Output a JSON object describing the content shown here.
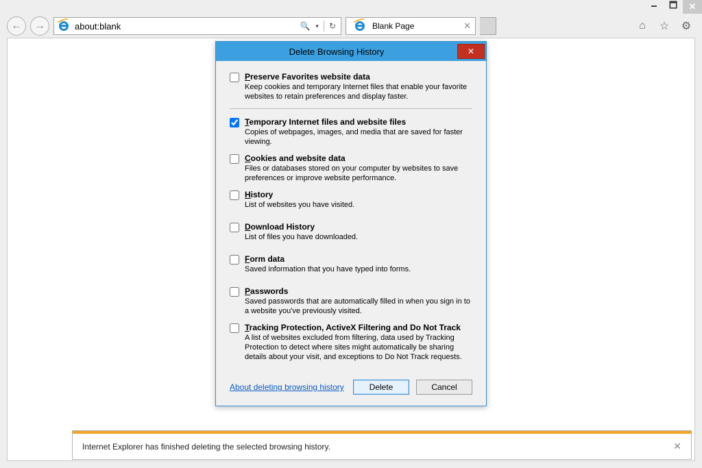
{
  "window": {
    "minimize_glyph": "🗕",
    "maximize_glyph": "🗖",
    "close_glyph": "✕"
  },
  "toolbar": {
    "back_glyph": "←",
    "forward_glyph": "→",
    "address_value": "about:blank",
    "search_glyph": "🔍",
    "dropdown_glyph": "▾",
    "refresh_glyph": "↻",
    "tab_label": "Blank Page",
    "tab_close_glyph": "✕",
    "home_glyph": "⌂",
    "star_glyph": "☆",
    "gear_glyph": "⚙"
  },
  "dialog": {
    "title": "Delete Browsing History",
    "close_glyph": "✕",
    "options": [
      {
        "checked": false,
        "underline": "P",
        "rest_label": "reserve Favorites website data",
        "desc": "Keep cookies and temporary Internet files that enable your favorite websites to retain preferences and display faster."
      },
      {
        "checked": true,
        "underline": "T",
        "rest_label": "emporary Internet files and website files",
        "desc": "Copies of webpages, images, and media that are saved for faster viewing."
      },
      {
        "checked": false,
        "underline": "C",
        "rest_label": "ookies and website data",
        "desc": "Files or databases stored on your computer by websites to save preferences or improve website performance."
      },
      {
        "checked": false,
        "underline": "H",
        "rest_label": "istory",
        "desc": "List of websites you have visited."
      },
      {
        "checked": false,
        "underline": "D",
        "rest_label": "ownload History",
        "desc": "List of files you have downloaded."
      },
      {
        "checked": false,
        "underline": "F",
        "rest_label": "orm data",
        "desc": "Saved information that you have typed into forms."
      },
      {
        "checked": false,
        "underline": "P",
        "rest_label": "asswords",
        "desc": "Saved passwords that are automatically filled in when you sign in to a website you've previously visited."
      },
      {
        "checked": false,
        "underline": "T",
        "rest_label": "racking Protection, ActiveX Filtering and Do Not Track",
        "desc": "A list of websites excluded from filtering, data used by Tracking Protection to detect where sites might automatically be sharing details about your visit, and exceptions to Do Not Track requests."
      }
    ],
    "about_link": "About deleting browsing history",
    "delete_label": "Delete",
    "cancel_label": "Cancel"
  },
  "notification": {
    "text": "Internet Explorer has finished deleting the selected browsing history.",
    "close_glyph": "✕"
  }
}
